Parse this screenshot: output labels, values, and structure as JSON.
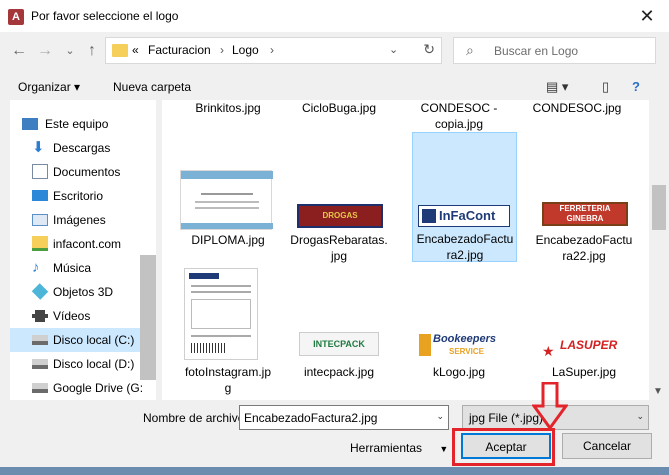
{
  "window": {
    "title": "Por favor seleccione el logo",
    "close_glyph": "✕"
  },
  "nav": {
    "back_glyph": "←",
    "forward_glyph": "→",
    "recent_glyph": "⌄",
    "up_glyph": "↑"
  },
  "address": {
    "overflow": "«",
    "crumbs": [
      "Facturacion",
      "Logo"
    ],
    "separator": "›",
    "refresh_glyph": "↻",
    "dropdown_glyph": "⌄"
  },
  "search": {
    "placeholder": "Buscar en Logo",
    "icon_glyph": "⌕"
  },
  "toolbar": {
    "organize": "Organizar ▾",
    "new_folder": "Nueva carpeta",
    "view_glyph": "▤ ▾",
    "preview_glyph": "▯",
    "help_glyph": "?"
  },
  "sidebar": {
    "items": [
      {
        "label": "Este equipo",
        "icon": "computer-icon",
        "color": "#3d7fc1"
      },
      {
        "label": "Descargas",
        "icon": "download-icon",
        "color": "#2b7cd3"
      },
      {
        "label": "Documentos",
        "icon": "documents-icon",
        "color": "#7a8aa0"
      },
      {
        "label": "Escritorio",
        "icon": "desktop-icon",
        "color": "#2b88d8"
      },
      {
        "label": "Imágenes",
        "icon": "pictures-icon",
        "color": "#5b8fc7"
      },
      {
        "label": "infacont.com",
        "icon": "network-folder-icon",
        "color": "#4a9e3f"
      },
      {
        "label": "Música",
        "icon": "music-icon",
        "color": "#2b88d8"
      },
      {
        "label": "Objetos 3D",
        "icon": "3d-objects-icon",
        "color": "#4cb5d8"
      },
      {
        "label": "Vídeos",
        "icon": "videos-icon",
        "color": "#444444"
      },
      {
        "label": "Disco local (C:)",
        "icon": "drive-c-icon",
        "color": "#6b6b6b"
      },
      {
        "label": "Disco local (D:)",
        "icon": "drive-d-icon",
        "color": "#6b6b6b"
      },
      {
        "label": "Google Drive (G:",
        "icon": "google-drive-icon",
        "color": "#6b6b6b"
      }
    ],
    "selected_index": 9
  },
  "files": {
    "top_row": [
      "Brinkitos.jpg",
      "CicloBuga.jpg",
      "CONDESOC -\ncopia.jpg",
      "CONDESOC.jpg"
    ],
    "row2": [
      {
        "name": "DIPLOMA.jpg",
        "thumb": "diploma"
      },
      {
        "name": "DrogasRebaratas.\njpg",
        "thumb": "drogas"
      },
      {
        "name": "EncabezadoFactu\nra2.jpg",
        "thumb": "infacont",
        "selected": true
      },
      {
        "name": "EncabezadoFactu\nra22.jpg",
        "thumb": "ferreteria"
      }
    ],
    "row3": [
      {
        "name": "fotoInstagram.jp\ng",
        "thumb": "instagram"
      },
      {
        "name": "intecpack.jpg",
        "thumb": "intecpack"
      },
      {
        "name": "kLogo.jpg",
        "thumb": "klogo"
      },
      {
        "name": "LaSuper.jpg",
        "thumb": "lasuper"
      }
    ],
    "thumb_texts": {
      "infacont": "InFaCont",
      "ferreteria_1": "FERRETERIA",
      "ferreteria_2": "GINEBRA",
      "intecpack": "INTECPACK",
      "klogo_1": "Bookeepers",
      "klogo_2": "SERVICE",
      "lasuper": "LASUPER",
      "drogas": "DROGAS"
    }
  },
  "footer": {
    "filename_label": "Nombre de archivo:",
    "filename_value": "EncabezadoFactura2.jpg",
    "filetype_value": "jpg File (*.jpg)",
    "tools_label": "Herramientas",
    "tools_dropdown": "▼",
    "accept": "Aceptar",
    "cancel": "Cancelar"
  },
  "colors": {
    "highlight": "#e3242b",
    "selection": "#cce8ff",
    "primary_border": "#0078d7"
  }
}
